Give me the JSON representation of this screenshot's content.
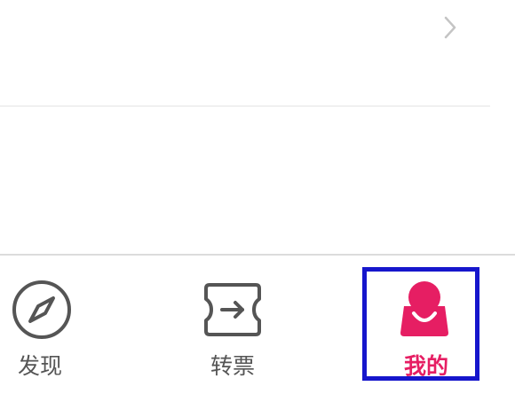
{
  "list": {
    "rows": [
      {
        "id": "row-1",
        "chevron_icon": "chevron-right-icon"
      },
      {
        "id": "row-2",
        "chevron_icon": "chevron-right-icon"
      }
    ]
  },
  "tabbar": {
    "tabs": [
      {
        "label": "发现",
        "icon": "compass-icon",
        "selected": false
      },
      {
        "label": "转票",
        "icon": "transfer-ticket-icon",
        "selected": false
      },
      {
        "label": "我的",
        "icon": "user-bag-icon",
        "selected": true
      }
    ],
    "colors": {
      "active": "#e61e63",
      "inactive": "#555555",
      "highlight_border": "#1616cc"
    }
  }
}
